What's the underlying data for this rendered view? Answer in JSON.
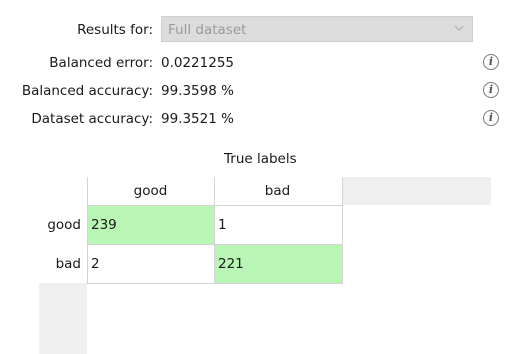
{
  "results_for": {
    "label": "Results for:",
    "value": "Full dataset"
  },
  "metrics": [
    {
      "label": "Balanced error:",
      "value": "0.0221255"
    },
    {
      "label": "Balanced accuracy:",
      "value": "99.3598 %"
    },
    {
      "label": "Dataset accuracy:",
      "value": "99.3521 %"
    }
  ],
  "info_glyph": "i",
  "confusion_matrix": {
    "title": "True labels",
    "columns": [
      "good",
      "bad"
    ],
    "rows": [
      {
        "label": "good",
        "cells": [
          "239",
          "1"
        ]
      },
      {
        "label": "bad",
        "cells": [
          "2",
          "221"
        ]
      }
    ],
    "highlight_color": "#b9f5b4"
  }
}
